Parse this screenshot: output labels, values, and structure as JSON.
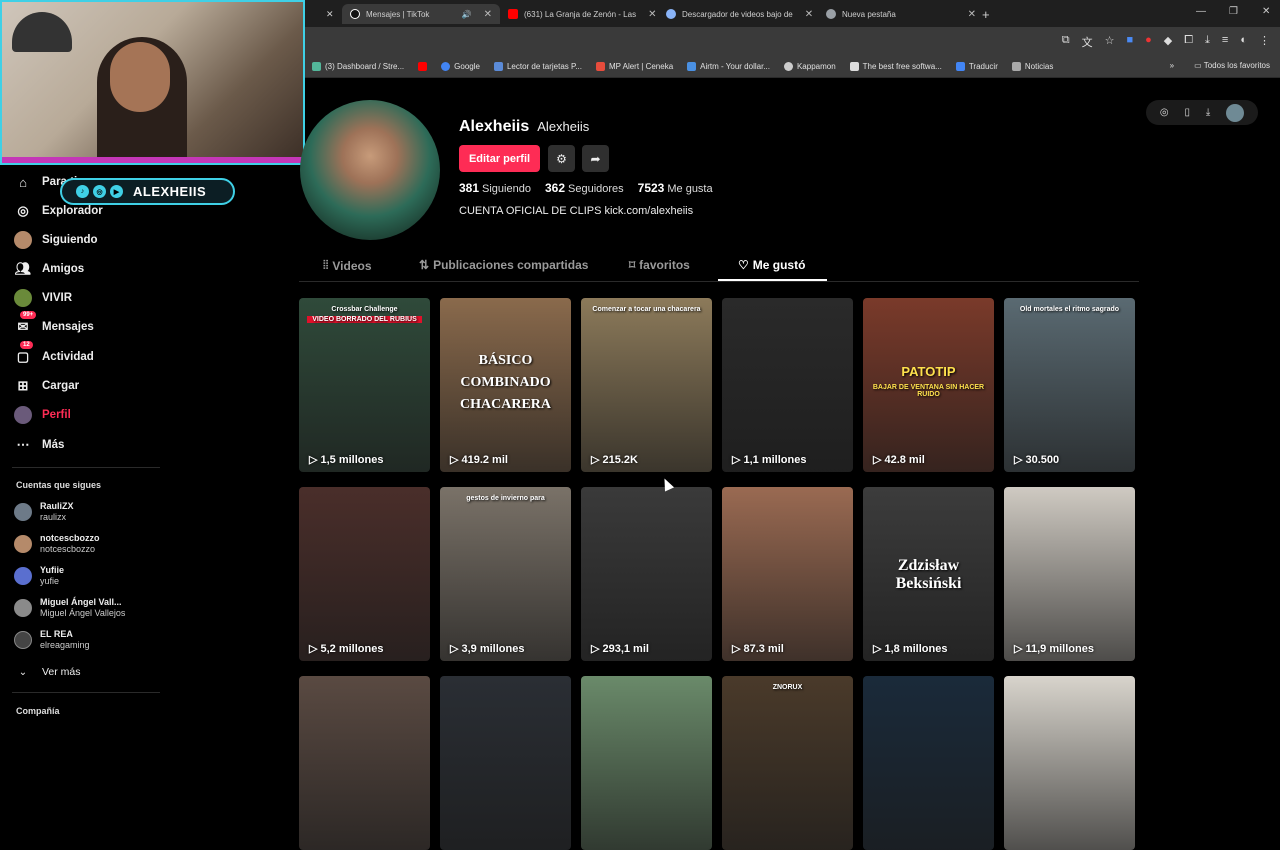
{
  "browser": {
    "tabs": [
      {
        "title": "Mensajes | TikTok",
        "color": "#000000"
      },
      {
        "title": "(631) La Granja de Zenón - Las",
        "color": "#ff0000"
      },
      {
        "title": "Descargador de videos bajo de",
        "color": "#8ab4f8"
      },
      {
        "title": "Nueva pestaña",
        "color": "#9aa0a6"
      }
    ],
    "new_tab": "+",
    "bookmarks": [
      {
        "label": "(3) Dashboard / Stre...",
        "color": "#53b79a"
      },
      {
        "label": "",
        "color": "#ff0000"
      },
      {
        "label": "Google",
        "color": "#4285f4"
      },
      {
        "label": "Lector de tarjetas P...",
        "color": "#5b8bd8"
      },
      {
        "label": "MP Alert | Ceneka",
        "color": "#e74c3c"
      },
      {
        "label": "Airtm - Your dollar...",
        "color": "#4a90e2"
      },
      {
        "label": "Kappamon",
        "color": "#cccccc"
      },
      {
        "label": "The best free softwa...",
        "color": "#dddddd"
      },
      {
        "label": "Traducir",
        "color": "#4285f4"
      },
      {
        "label": "Noticias",
        "color": "#aaaaaa"
      }
    ],
    "bookmarks_right": "Todos los favoritos"
  },
  "stream_overlay": {
    "name": "ALEXHEIIS"
  },
  "sidebar": {
    "items": [
      {
        "label": "Para ti",
        "icon": "home-icon"
      },
      {
        "label": "Explorador",
        "icon": "compass-icon"
      },
      {
        "label": "Siguiendo",
        "icon": "avatar"
      },
      {
        "label": "Amigos",
        "icon": "people-icon"
      },
      {
        "label": "VIVIR",
        "icon": "live-icon"
      },
      {
        "label": "Mensajes",
        "icon": "message-icon",
        "badge": "99+"
      },
      {
        "label": "Actividad",
        "icon": "activity-icon",
        "badge": "12"
      },
      {
        "label": "Cargar",
        "icon": "upload-icon"
      },
      {
        "label": "Perfil",
        "icon": "profile-icon"
      },
      {
        "label": "Más",
        "icon": "more-icon"
      }
    ],
    "following_title": "Cuentas que sigues",
    "following": [
      {
        "name": "RauliZX",
        "user": "raulizx",
        "color": "#6d7a88"
      },
      {
        "name": "notcescbozzo",
        "user": "notcescbozzo",
        "color": "#b58a6a"
      },
      {
        "name": "Yufiie",
        "user": "yufie",
        "color": "#5a6fcf"
      },
      {
        "name": "Miguel Ángel Vall...",
        "user": "Miguel Ángel Vallejos",
        "color": "#8a8a8a"
      },
      {
        "name": "EL REA",
        "user": "elreagaming",
        "color": "#444444"
      }
    ],
    "see_more": "Ver más",
    "footer": "Compañía"
  },
  "profile": {
    "display_name": "Alexheiis",
    "username": "Alexheiis",
    "edit_button": "Editar perfil",
    "following_count": "381",
    "following_label": "Siguiendo",
    "followers_count": "362",
    "followers_label": "Seguidores",
    "likes_count": "7523",
    "likes_label": "Me gusta",
    "bio": "CUENTA OFICIAL DE CLIPS kick.com/alexheiis"
  },
  "tabs": [
    {
      "label": "Videos",
      "icon": "grid-icon"
    },
    {
      "label": "Publicaciones compartidas",
      "icon": "repost-icon"
    },
    {
      "label": "favoritos",
      "icon": "bookmark-icon"
    },
    {
      "label": "Me gustó",
      "icon": "heart-icon"
    }
  ],
  "videos": [
    {
      "views": "1,5 millones",
      "caption": "Crossbar Challenge",
      "caption2": "VIDEO BORRADO DEL RUBIUS",
      "bg": "#2f4a3a"
    },
    {
      "views": "419.2 mil",
      "caption": "BÁSICO COMBINADO CHACARERA",
      "caption2": "",
      "bg": "#8a6a4c"
    },
    {
      "views": "215.2K",
      "caption": "Comenzar a tocar una chacarera",
      "caption2": "",
      "bg": "#8c7a5a"
    },
    {
      "views": "1,1 millones",
      "caption": "",
      "caption2": "",
      "bg": "#2a2a2a"
    },
    {
      "views": "42.8 mil",
      "caption": "PATOTIP",
      "caption2": "BAJAR DE VENTANA SIN HACER RUIDO",
      "bg": "#7a3a2a"
    },
    {
      "views": "30.500",
      "caption": "Old mortales el ritmo sagrado",
      "caption2": "",
      "bg": "#5a6a72"
    },
    {
      "views": "5,2 millones",
      "caption": "",
      "caption2": "",
      "bg": "#4a2e2a"
    },
    {
      "views": "3,9 millones",
      "caption": "gestos de invierno para",
      "caption2": "",
      "bg": "#7a7268"
    },
    {
      "views": "293,1 mil",
      "caption": "",
      "caption2": "",
      "bg": "#3a3a3a"
    },
    {
      "views": "87.3 mil",
      "caption": "",
      "caption2": "",
      "bg": "#9a6a52"
    },
    {
      "views": "1,8 millones",
      "caption": "Zdzisław Beksiński",
      "caption2": "",
      "bg": "#3c3c3c"
    },
    {
      "views": "11,9 millones",
      "caption": "",
      "caption2": "",
      "bg": "#cfcac2"
    },
    {
      "views": "",
      "caption": "",
      "caption2": "",
      "bg": "#5a4a42"
    },
    {
      "views": "",
      "caption": "",
      "caption2": "",
      "bg": "#2a2e34"
    },
    {
      "views": "",
      "caption": "",
      "caption2": "",
      "bg": "#6a8a6a"
    },
    {
      "views": "",
      "caption": "ZNORUX",
      "caption2": "",
      "bg": "#4a3a2a"
    },
    {
      "views": "",
      "caption": "",
      "caption2": "",
      "bg": "#1a2a3a"
    },
    {
      "views": "",
      "caption": "",
      "caption2": "",
      "bg": "#d8d4cc"
    }
  ]
}
